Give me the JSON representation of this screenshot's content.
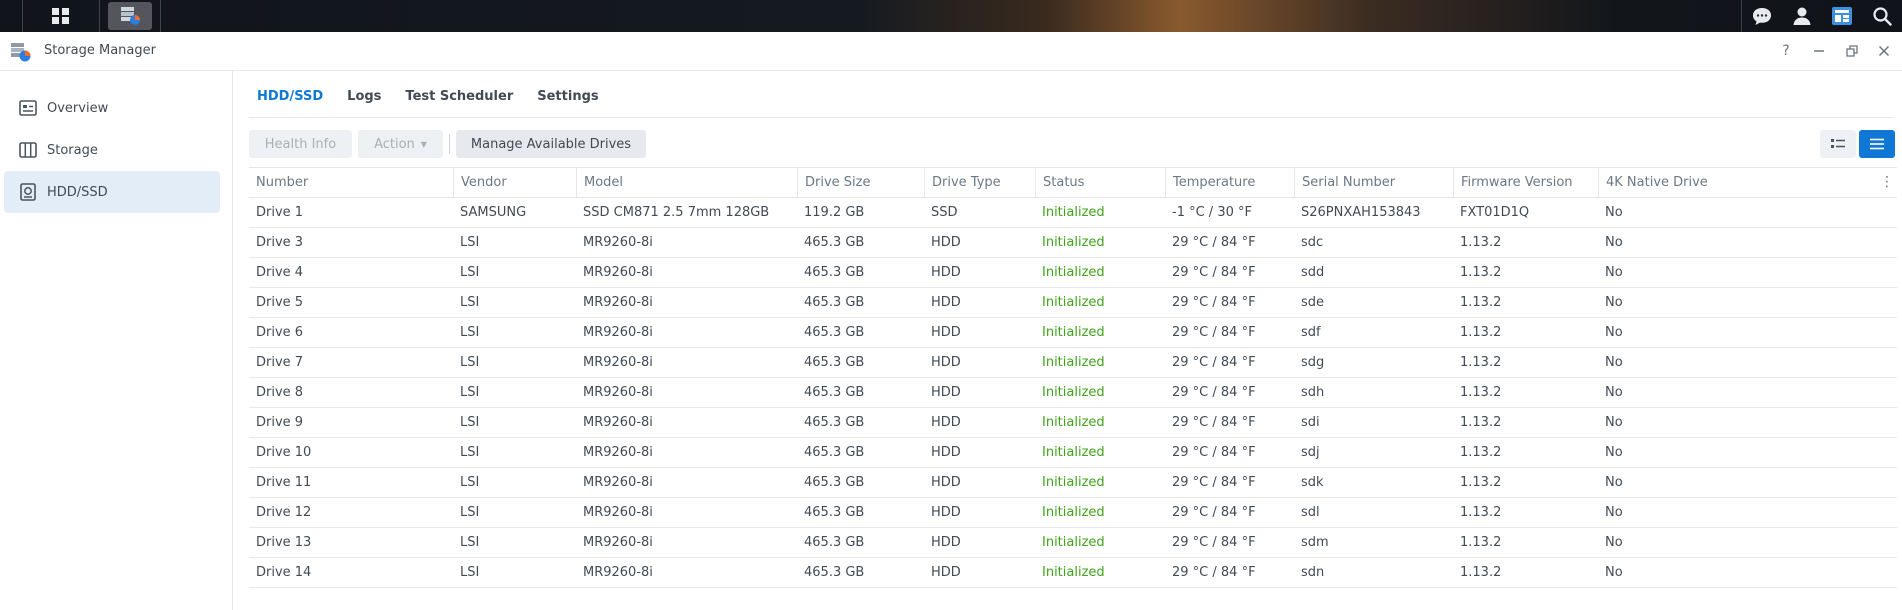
{
  "taskbar": {
    "left_icons": [
      "grid-icon",
      "storage-manager-app-icon"
    ],
    "right_icons": [
      "chat-icon",
      "user-icon",
      "widgets-icon",
      "search-icon"
    ]
  },
  "window": {
    "title": "Storage Manager",
    "controls": [
      "help-icon",
      "minimize-icon",
      "restore-icon",
      "close-icon"
    ]
  },
  "sidebar": {
    "items": [
      {
        "label": "Overview",
        "icon": "overview-icon"
      },
      {
        "label": "Storage",
        "icon": "storage-icon"
      },
      {
        "label": "HDD/SSD",
        "icon": "hdd-icon",
        "active": true
      }
    ]
  },
  "tabs": [
    {
      "label": "HDD/SSD",
      "active": true
    },
    {
      "label": "Logs"
    },
    {
      "label": "Test Scheduler"
    },
    {
      "label": "Settings"
    }
  ],
  "toolbar": {
    "health_info": "Health Info",
    "action": "Action",
    "manage_drives": "Manage Available Drives"
  },
  "table": {
    "columns": [
      "Number",
      "Vendor",
      "Model",
      "Drive Size",
      "Drive Type",
      "Status",
      "Temperature",
      "Serial Number",
      "Firmware Version",
      "4K Native Drive"
    ],
    "rows": [
      [
        "Drive 1",
        "SAMSUNG",
        "SSD CM871 2.5 7mm 128GB",
        "119.2 GB",
        "SSD",
        "Initialized",
        "-1 °C / 30 °F",
        "S26PNXAH153843",
        "FXT01D1Q",
        "No"
      ],
      [
        "Drive 3",
        "LSI",
        "MR9260-8i",
        "465.3 GB",
        "HDD",
        "Initialized",
        "29 °C / 84 °F",
        "sdc",
        "1.13.2",
        "No"
      ],
      [
        "Drive 4",
        "LSI",
        "MR9260-8i",
        "465.3 GB",
        "HDD",
        "Initialized",
        "29 °C / 84 °F",
        "sdd",
        "1.13.2",
        "No"
      ],
      [
        "Drive 5",
        "LSI",
        "MR9260-8i",
        "465.3 GB",
        "HDD",
        "Initialized",
        "29 °C / 84 °F",
        "sde",
        "1.13.2",
        "No"
      ],
      [
        "Drive 6",
        "LSI",
        "MR9260-8i",
        "465.3 GB",
        "HDD",
        "Initialized",
        "29 °C / 84 °F",
        "sdf",
        "1.13.2",
        "No"
      ],
      [
        "Drive 7",
        "LSI",
        "MR9260-8i",
        "465.3 GB",
        "HDD",
        "Initialized",
        "29 °C / 84 °F",
        "sdg",
        "1.13.2",
        "No"
      ],
      [
        "Drive 8",
        "LSI",
        "MR9260-8i",
        "465.3 GB",
        "HDD",
        "Initialized",
        "29 °C / 84 °F",
        "sdh",
        "1.13.2",
        "No"
      ],
      [
        "Drive 9",
        "LSI",
        "MR9260-8i",
        "465.3 GB",
        "HDD",
        "Initialized",
        "29 °C / 84 °F",
        "sdi",
        "1.13.2",
        "No"
      ],
      [
        "Drive 10",
        "LSI",
        "MR9260-8i",
        "465.3 GB",
        "HDD",
        "Initialized",
        "29 °C / 84 °F",
        "sdj",
        "1.13.2",
        "No"
      ],
      [
        "Drive 11",
        "LSI",
        "MR9260-8i",
        "465.3 GB",
        "HDD",
        "Initialized",
        "29 °C / 84 °F",
        "sdk",
        "1.13.2",
        "No"
      ],
      [
        "Drive 12",
        "LSI",
        "MR9260-8i",
        "465.3 GB",
        "HDD",
        "Initialized",
        "29 °C / 84 °F",
        "sdl",
        "1.13.2",
        "No"
      ],
      [
        "Drive 13",
        "LSI",
        "MR9260-8i",
        "465.3 GB",
        "HDD",
        "Initialized",
        "29 °C / 84 °F",
        "sdm",
        "1.13.2",
        "No"
      ],
      [
        "Drive 14",
        "LSI",
        "MR9260-8i",
        "465.3 GB",
        "HDD",
        "Initialized",
        "29 °C / 84 °F",
        "sdn",
        "1.13.2",
        "No"
      ]
    ]
  },
  "colors": {
    "accent": "#0f78d4",
    "status_ok": "#3fa31a"
  }
}
